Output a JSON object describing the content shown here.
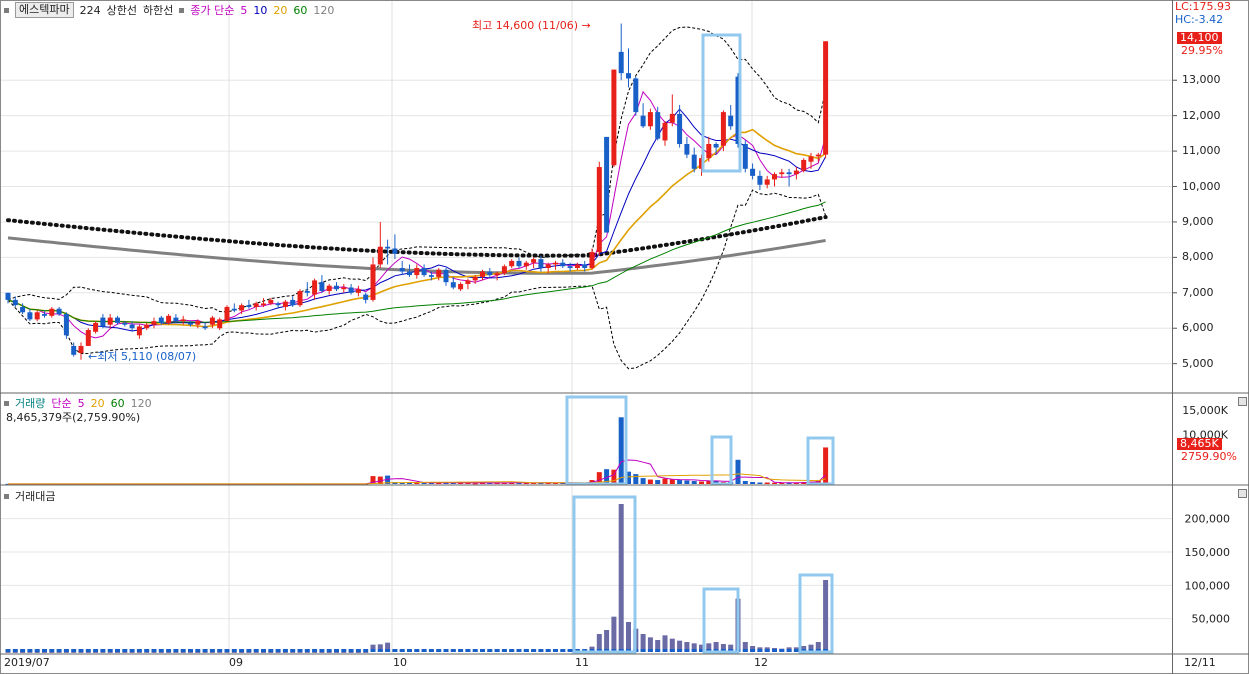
{
  "header": {
    "stock_name": "에스텍파마",
    "code": "224",
    "upper_label": "상한선",
    "lower_label": "하한선",
    "ma_title": "종가 단순",
    "ma_periods": [
      "5",
      "10",
      "20",
      "60",
      "120"
    ],
    "ma_colors": [
      "#c000c0",
      "#0000c0",
      "#e0a000",
      "#008000",
      "#808080"
    ]
  },
  "price_axis": {
    "ticks": [
      "13,000",
      "12,000",
      "11,000",
      "10,000",
      "9,000",
      "8,000",
      "7,000",
      "6,000",
      "5,000"
    ],
    "lc": "LC:175.93",
    "hc": "HC:-3.42",
    "last": "14,100",
    "last_pct": "29.95%"
  },
  "annotations": {
    "high": "최고 14,600 (11/06)",
    "low": "최저 5,110 (08/07)"
  },
  "volume": {
    "title": "거래량",
    "ma_title": "단순",
    "ma_periods": [
      "5",
      "20",
      "60",
      "120"
    ],
    "ma_colors": [
      "#c000c0",
      "#e0a000",
      "#008000",
      "#808080"
    ],
    "last_value": "8,465,379주(2,759.90%)",
    "ticks": [
      "15,000K",
      "10,000K"
    ],
    "last": "8,465K",
    "last_pct": "2759.90%"
  },
  "amount": {
    "title": "거래대금",
    "ticks": [
      "200,000",
      "150,000",
      "100,000",
      "50,000"
    ]
  },
  "x_axis": {
    "labels": [
      "2019/07",
      "09",
      "10",
      "11",
      "12",
      "12/11"
    ]
  },
  "colors": {
    "up": "#e8201a",
    "down": "#1860c8",
    "box": "#90c8ee",
    "amount_bar": "#6a6aa4"
  },
  "chart_data": [
    {
      "type": "candlestick",
      "panel": "price",
      "x_label_positions": [
        "2019/07",
        "09",
        "10",
        "11",
        "12"
      ],
      "ylim": [
        4200,
        14700
      ],
      "candles": [
        [
          7000,
          7000,
          6700,
          6800
        ],
        [
          6800,
          6900,
          6600,
          6650
        ],
        [
          6600,
          6700,
          6400,
          6450
        ],
        [
          6450,
          6550,
          6200,
          6250
        ],
        [
          6250,
          6500,
          6200,
          6450
        ],
        [
          6400,
          6500,
          6300,
          6350
        ],
        [
          6350,
          6600,
          6300,
          6550
        ],
        [
          6550,
          6600,
          6350,
          6400
        ],
        [
          6400,
          6450,
          5700,
          5800
        ],
        [
          5500,
          5600,
          5200,
          5250
        ],
        [
          5300,
          5600,
          5110,
          5500
        ],
        [
          5500,
          6000,
          5500,
          5950
        ],
        [
          5900,
          6200,
          5850,
          6150
        ],
        [
          6300,
          6400,
          6000,
          6050
        ],
        [
          6100,
          6400,
          6000,
          6300
        ],
        [
          6300,
          6350,
          6100,
          6150
        ],
        [
          6150,
          6200,
          6050,
          6100
        ],
        [
          6100,
          6200,
          5900,
          6000
        ],
        [
          5800,
          6100,
          5700,
          6050
        ],
        [
          6000,
          6150,
          5950,
          6100
        ],
        [
          6100,
          6300,
          6000,
          6200
        ],
        [
          6300,
          6350,
          6100,
          6150
        ],
        [
          6150,
          6400,
          6100,
          6350
        ],
        [
          6300,
          6400,
          6150,
          6200
        ],
        [
          6200,
          6350,
          6100,
          6250
        ],
        [
          6150,
          6200,
          6050,
          6100
        ],
        [
          6100,
          6250,
          6000,
          6200
        ],
        [
          6050,
          6150,
          5950,
          6000
        ],
        [
          6100,
          6350,
          6000,
          6300
        ],
        [
          6000,
          6300,
          5950,
          6250
        ],
        [
          6200,
          6650,
          6200,
          6600
        ],
        [
          6550,
          6700,
          6450,
          6500
        ],
        [
          6500,
          6700,
          6400,
          6650
        ],
        [
          6650,
          6800,
          6550,
          6600
        ],
        [
          6600,
          6750,
          6500,
          6700
        ],
        [
          6650,
          6850,
          6600,
          6700
        ],
        [
          6700,
          6850,
          6650,
          6800
        ],
        [
          6700,
          6750,
          6550,
          6650
        ],
        [
          6600,
          6800,
          6500,
          6750
        ],
        [
          6800,
          6900,
          6600,
          6650
        ],
        [
          6650,
          7100,
          6600,
          7050
        ],
        [
          7050,
          7300,
          6900,
          7000
        ],
        [
          6950,
          7400,
          6800,
          7350
        ],
        [
          7300,
          7500,
          7000,
          7050
        ],
        [
          7050,
          7250,
          6950,
          7200
        ],
        [
          7200,
          7300,
          7050,
          7100
        ],
        [
          7100,
          7250,
          7000,
          7150
        ],
        [
          7150,
          7250,
          6950,
          7000
        ],
        [
          7000,
          7200,
          6900,
          7100
        ],
        [
          6950,
          7000,
          6700,
          6800
        ],
        [
          6800,
          8000,
          6750,
          7800
        ],
        [
          7800,
          9000,
          7700,
          8300
        ],
        [
          8300,
          8500,
          7800,
          8250
        ],
        [
          8250,
          8650,
          7950,
          8100
        ],
        [
          7700,
          7900,
          7500,
          7600
        ],
        [
          7600,
          7800,
          7450,
          7500
        ],
        [
          7500,
          7800,
          7400,
          7700
        ],
        [
          7700,
          7800,
          7450,
          7500
        ],
        [
          7500,
          7600,
          7350,
          7450
        ],
        [
          7450,
          7700,
          7350,
          7650
        ],
        [
          7650,
          7700,
          7200,
          7300
        ],
        [
          7300,
          7450,
          7100,
          7150
        ],
        [
          7100,
          7300,
          7050,
          7250
        ],
        [
          7250,
          7400,
          7100,
          7350
        ],
        [
          7350,
          7500,
          7250,
          7450
        ],
        [
          7450,
          7650,
          7350,
          7600
        ],
        [
          7600,
          7700,
          7450,
          7500
        ],
        [
          7500,
          7600,
          7350,
          7550
        ],
        [
          7550,
          7800,
          7500,
          7750
        ],
        [
          7750,
          7950,
          7700,
          7900
        ],
        [
          7900,
          8000,
          7700,
          7750
        ],
        [
          7750,
          7900,
          7650,
          7850
        ],
        [
          7850,
          8000,
          7700,
          7950
        ],
        [
          7950,
          8050,
          7600,
          7700
        ],
        [
          7700,
          7850,
          7550,
          7800
        ],
        [
          7800,
          7900,
          7650,
          7850
        ],
        [
          7850,
          7950,
          7700,
          7750
        ],
        [
          7750,
          7850,
          7600,
          7700
        ],
        [
          7700,
          7850,
          7650,
          7800
        ],
        [
          7800,
          7900,
          7600,
          7700
        ],
        [
          7700,
          8250,
          7650,
          8150
        ],
        [
          8150,
          10700,
          8050,
          10550
        ],
        [
          11400,
          11400,
          8700,
          8700
        ],
        [
          10600,
          13300,
          10550,
          13300
        ],
        [
          13800,
          14600,
          13000,
          13200
        ],
        [
          13200,
          13900,
          12800,
          13050
        ],
        [
          13050,
          13100,
          12000,
          12100
        ],
        [
          12000,
          12350,
          11650,
          11700
        ],
        [
          11700,
          12200,
          11600,
          12100
        ],
        [
          12100,
          12250,
          11300,
          11350
        ],
        [
          11300,
          11850,
          11150,
          11800
        ],
        [
          11800,
          12600,
          11700,
          12050
        ],
        [
          12050,
          12300,
          11100,
          11200
        ],
        [
          11200,
          11400,
          10800,
          10900
        ],
        [
          10900,
          11100,
          10400,
          10500
        ],
        [
          10500,
          10900,
          10300,
          10800
        ],
        [
          10800,
          11400,
          10700,
          11200
        ],
        [
          11200,
          11250,
          10900,
          11100
        ],
        [
          11150,
          12150,
          11000,
          12100
        ],
        [
          12000,
          12300,
          11600,
          11700
        ],
        [
          13100,
          13200,
          11100,
          11200
        ],
        [
          11200,
          11300,
          10400,
          10500
        ],
        [
          10500,
          10650,
          10200,
          10300
        ],
        [
          10300,
          10450,
          9900,
          10050
        ],
        [
          10050,
          10300,
          9950,
          10200
        ],
        [
          10200,
          10400,
          10000,
          10350
        ],
        [
          10350,
          10500,
          10250,
          10400
        ],
        [
          10400,
          10500,
          10000,
          10350
        ],
        [
          10350,
          10550,
          10200,
          10450
        ],
        [
          10450,
          10800,
          10400,
          10750
        ],
        [
          10700,
          10950,
          10500,
          10850
        ],
        [
          10850,
          10950,
          10700,
          10900
        ],
        [
          10900,
          14100,
          10800,
          14100
        ]
      ],
      "ma_series": [
        "5",
        "10",
        "20",
        "60",
        "120"
      ],
      "bollinger": "upper/lower",
      "highlight_boxes": [
        "11/06 window",
        "late November"
      ]
    },
    {
      "type": "bar",
      "panel": "volume",
      "unit": "K",
      "ylim": [
        0,
        17000
      ],
      "values": [
        30,
        25,
        20,
        30,
        15,
        20,
        15,
        20,
        25,
        30,
        20,
        15,
        20,
        30,
        15,
        20,
        15,
        20,
        25,
        30,
        20,
        15,
        10,
        15,
        20,
        15,
        10,
        15,
        20,
        25,
        20,
        15,
        10,
        15,
        20,
        15,
        10,
        15,
        20,
        25,
        30,
        25,
        20,
        15,
        10,
        15,
        20,
        15,
        10,
        15,
        1600,
        1500,
        1700,
        400,
        300,
        250,
        200,
        300,
        250,
        200,
        250,
        300,
        200,
        250,
        150,
        200,
        250,
        300,
        200,
        250,
        300,
        350,
        250,
        200,
        300,
        250,
        200,
        250,
        150,
        200,
        800,
        2400,
        3000,
        2900,
        13500,
        2500,
        2000,
        1200,
        900,
        800,
        1100,
        900,
        800,
        700,
        600,
        500,
        600,
        700,
        400,
        400,
        4900,
        600,
        400,
        300,
        300,
        250,
        200,
        300,
        300,
        400,
        500,
        700,
        7400
      ],
      "ma_series": [
        "5",
        "20",
        "60",
        "120"
      ],
      "highlight_boxes": [
        "11/06 window",
        "late November",
        "12/11"
      ]
    },
    {
      "type": "bar",
      "panel": "trading_value",
      "unit": "백만원",
      "ylim": [
        0,
        240000
      ],
      "values": [
        200,
        150,
        120,
        180,
        100,
        140,
        100,
        120,
        150,
        180,
        120,
        100,
        130,
        180,
        100,
        120,
        100,
        120,
        150,
        180,
        130,
        100,
        80,
        100,
        130,
        100,
        80,
        100,
        130,
        160,
        140,
        110,
        80,
        100,
        130,
        110,
        80,
        110,
        140,
        170,
        200,
        180,
        150,
        120,
        90,
        110,
        140,
        110,
        90,
        110,
        11000,
        11500,
        14000,
        3500,
        3000,
        2500,
        2200,
        3000,
        2500,
        2200,
        2600,
        3000,
        2300,
        2600,
        1800,
        2300,
        2700,
        3100,
        2400,
        2800,
        3300,
        3800,
        2900,
        2400,
        3400,
        2900,
        2400,
        2900,
        1900,
        2400,
        8000,
        27000,
        33000,
        53000,
        222000,
        45000,
        35000,
        27000,
        22000,
        18000,
        25000,
        20000,
        17000,
        15000,
        13000,
        11000,
        13000,
        15000,
        12000,
        11000,
        80000,
        15000,
        9000,
        7000,
        7000,
        6000,
        5000,
        7000,
        7000,
        9000,
        11000,
        15000,
        108000
      ],
      "highlight_boxes": [
        "11/06 window",
        "late November",
        "12/11"
      ]
    }
  ]
}
